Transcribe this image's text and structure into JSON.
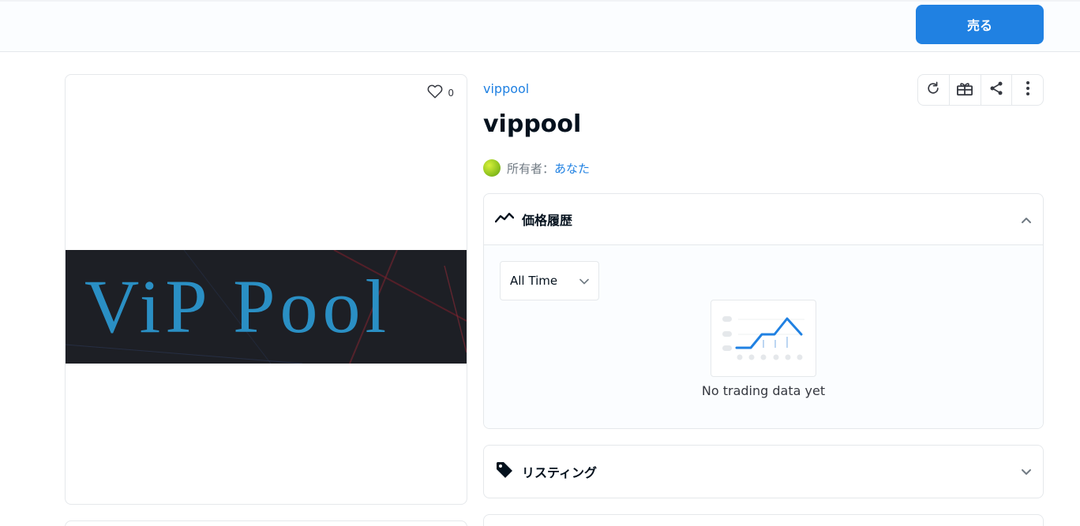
{
  "header": {
    "sell_label": "売る"
  },
  "media": {
    "favorite_count": "0",
    "image_text": "ViP Pool"
  },
  "item": {
    "collection_name": "vippool",
    "title": "vippool",
    "owner_label": "所有者：",
    "owner_name": "あなた"
  },
  "actions": [
    "refresh-icon",
    "gift-icon",
    "share-icon",
    "more-icon"
  ],
  "price_history": {
    "title": "価格履歴",
    "filter_selected": "All Time",
    "empty_text": "No trading data yet"
  },
  "listings": {
    "title": "リスティング"
  },
  "colors": {
    "accent": "#2081e2",
    "border": "#e5e8eb",
    "text": "#04111d",
    "muted": "#707a83"
  }
}
